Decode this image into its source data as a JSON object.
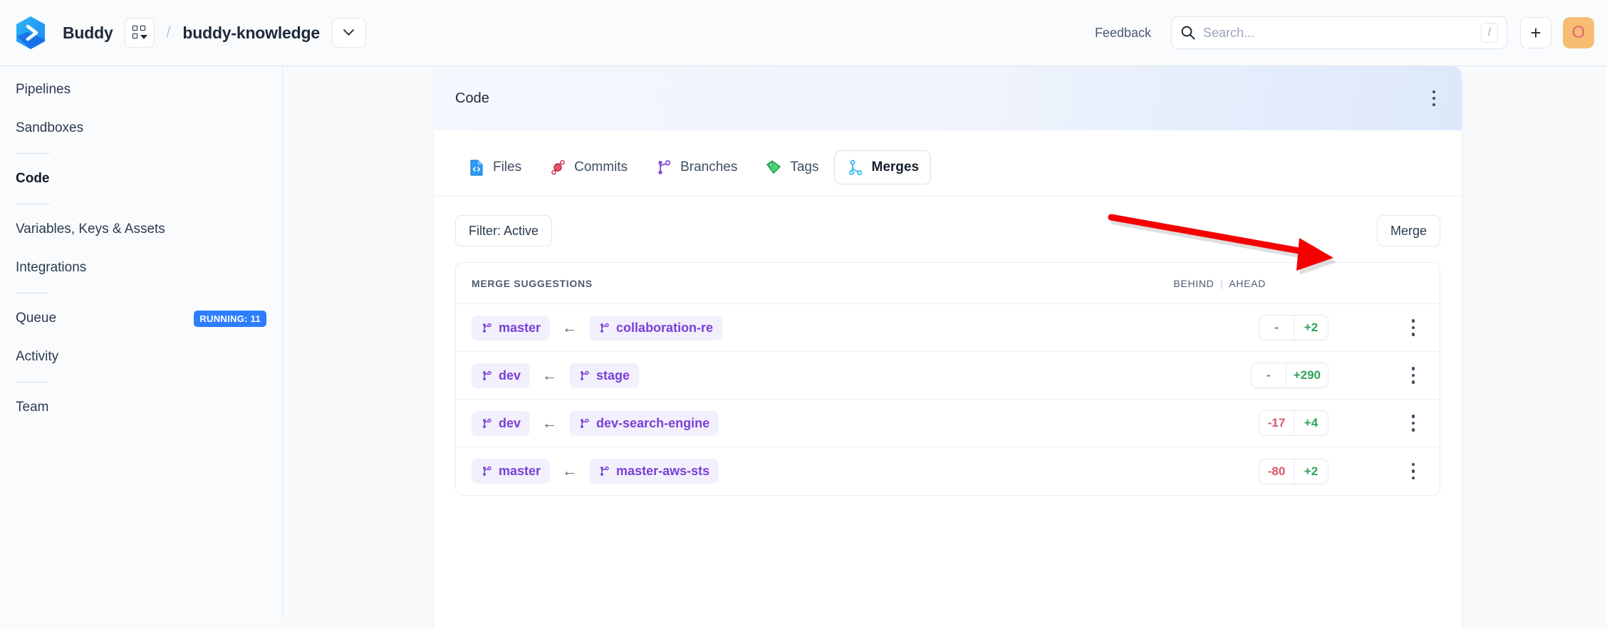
{
  "topbar": {
    "logo_icon": "buddy-hexagon-logo",
    "brand": "Buddy",
    "grid_icon": "grid-apps-icon",
    "breadcrumb_separator": "/",
    "repo": "buddy-knowledge",
    "repo_caret_icon": "chevron-down-icon",
    "feedback": "Feedback",
    "search_icon": "search-icon",
    "search_placeholder": "Search...",
    "search_value": "",
    "search_shortcut": "/",
    "plus_label": "+",
    "avatar_letter": "O",
    "avatar_color": "#f7bd72",
    "avatar_text_color": "#dc6878"
  },
  "sidebar": {
    "items": [
      {
        "label": "Pipelines",
        "active": false,
        "badge": null
      },
      {
        "label": "Sandboxes",
        "active": false,
        "badge": null
      },
      {
        "label": "Code",
        "active": true,
        "badge": null
      },
      {
        "label": "Variables, Keys & Assets",
        "active": false,
        "badge": null
      },
      {
        "label": "Integrations",
        "active": false,
        "badge": null
      },
      {
        "label": "Queue",
        "active": false,
        "badge": "RUNNING: 11"
      },
      {
        "label": "Activity",
        "active": false,
        "badge": null
      },
      {
        "label": "Team",
        "active": false,
        "badge": null
      }
    ],
    "badge_color": "#2d7dff"
  },
  "card": {
    "title": "Code",
    "menu_icon": "kebab-menu-icon"
  },
  "tabs": [
    {
      "label": "Files",
      "icon": "file-code-icon",
      "active": false
    },
    {
      "label": "Commits",
      "icon": "commits-icon",
      "active": false
    },
    {
      "label": "Branches",
      "icon": "branch-fork-icon",
      "active": false
    },
    {
      "label": "Tags",
      "icon": "tag-icon",
      "active": false
    },
    {
      "label": "Merges",
      "icon": "merge-icon",
      "active": true
    }
  ],
  "toolbar": {
    "filter_label": "Filter: Active",
    "merge_label": "Merge"
  },
  "table": {
    "header_left": "MERGE SUGGESTIONS",
    "header_right_behind": "BEHIND",
    "header_right_separator": "|",
    "header_right_ahead": "AHEAD",
    "rows": [
      {
        "target": "master",
        "arrow": "←",
        "source": "collaboration-re",
        "behind": "-",
        "ahead": "+2",
        "menu_icon": "kebab-menu-icon"
      },
      {
        "target": "dev",
        "arrow": "←",
        "source": "stage",
        "behind": "-",
        "ahead": "+290",
        "menu_icon": "kebab-menu-icon"
      },
      {
        "target": "dev",
        "arrow": "←",
        "source": "dev-search-engine",
        "behind": "-17",
        "ahead": "+4",
        "menu_icon": "kebab-menu-icon"
      },
      {
        "target": "master",
        "arrow": "←",
        "source": "master-aws-sts",
        "behind": "-80",
        "ahead": "+2",
        "menu_icon": "kebab-menu-icon"
      }
    ]
  },
  "annotation": {
    "type": "red-arrow",
    "color": "#f40000",
    "points_to": "merge-button"
  },
  "colors": {
    "accent_blue": "#2d7dff",
    "branch_purple": "#7a3fd6",
    "branch_chip_bg": "#f2f0fd",
    "ahead_green": "#2fa15c",
    "behind_red": "#d9566c",
    "page_bg": "#f8fafc"
  }
}
